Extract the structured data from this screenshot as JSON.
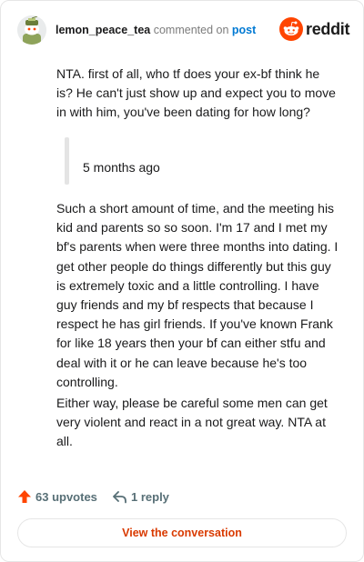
{
  "comment": {
    "username": "lemon_peace_tea",
    "action_text": "commented on",
    "post_link_label": "post",
    "brand_name": "reddit",
    "paragraph_1": "NTA. first of all, who tf does your ex-bf think he is? He can't just show up and expect you to move in with him, you've been dating for how long?",
    "quote": "5 months ago",
    "paragraph_2": "Such a short amount of time, and the meeting his kid and parents so so soon. I'm 17 and I met my bf's parents when were three months into dating. I get other people do things differently but this guy is extremely toxic and a little controlling. I have guy friends and my bf respects that because I respect he has girl friends. If you've known Frank for like 18 years then your bf can either stfu and deal with it or he can leave because he's too controlling.",
    "paragraph_3": "Either way, please be careful some men can get very violent and react in a not great way. NTA at all."
  },
  "footer": {
    "upvotes_label": "63 upvotes",
    "replies_label": "1 reply",
    "view_conversation_label": "View the conversation"
  },
  "icons": {
    "avatar": "snoo-avatar",
    "brand": "reddit-alien-icon",
    "upvote": "upvote-arrow-icon",
    "reply": "reply-arrow-icon"
  },
  "colors": {
    "brand_orange": "#ff4500",
    "link_blue": "#0079d3",
    "upvote_orange": "#ff4500",
    "action_text": "#d93a00",
    "meta_gray": "#576f76"
  }
}
